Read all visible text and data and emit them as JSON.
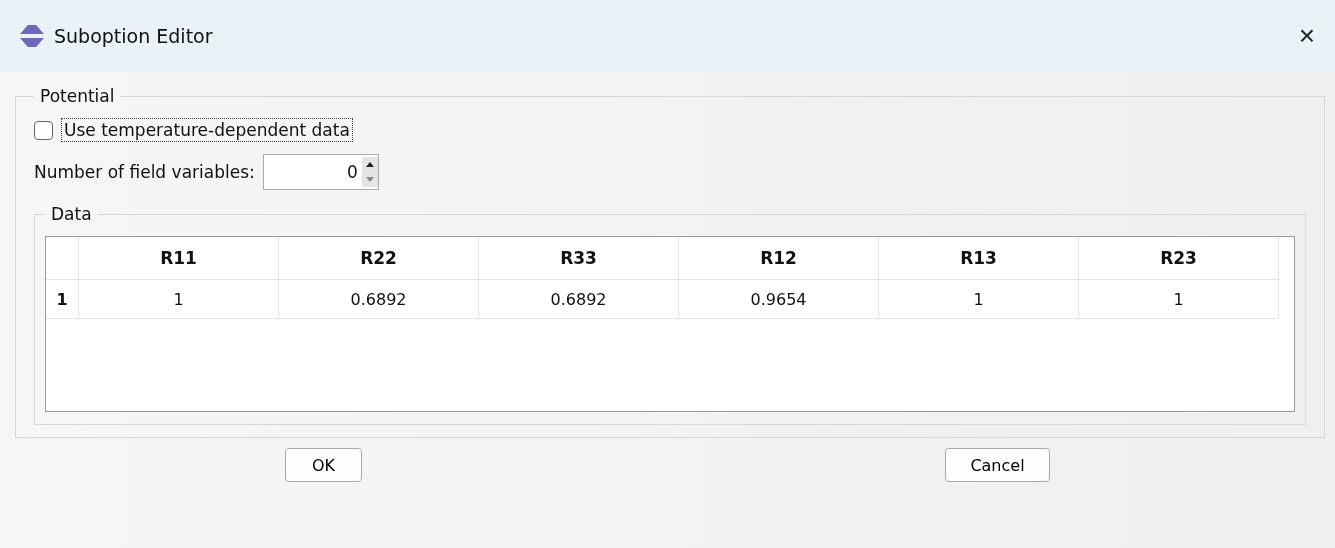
{
  "window": {
    "title": "Suboption Editor",
    "close": "×"
  },
  "potential": {
    "title": "Potential",
    "use_temperature": {
      "label": "Use temperature-dependent data",
      "checked": false,
      "focused": true
    },
    "field_variables": {
      "label": "Number of field variables:",
      "value": "0"
    },
    "data": {
      "title": "Data",
      "columns": [
        "R11",
        "R22",
        "R33",
        "R12",
        "R13",
        "R23"
      ],
      "rows": [
        {
          "header": "1",
          "cells": [
            "1",
            "0.6892",
            "0.6892",
            "0.9654",
            "1",
            "1"
          ]
        }
      ]
    }
  },
  "buttons": [
    "OK",
    "Cancel"
  ]
}
